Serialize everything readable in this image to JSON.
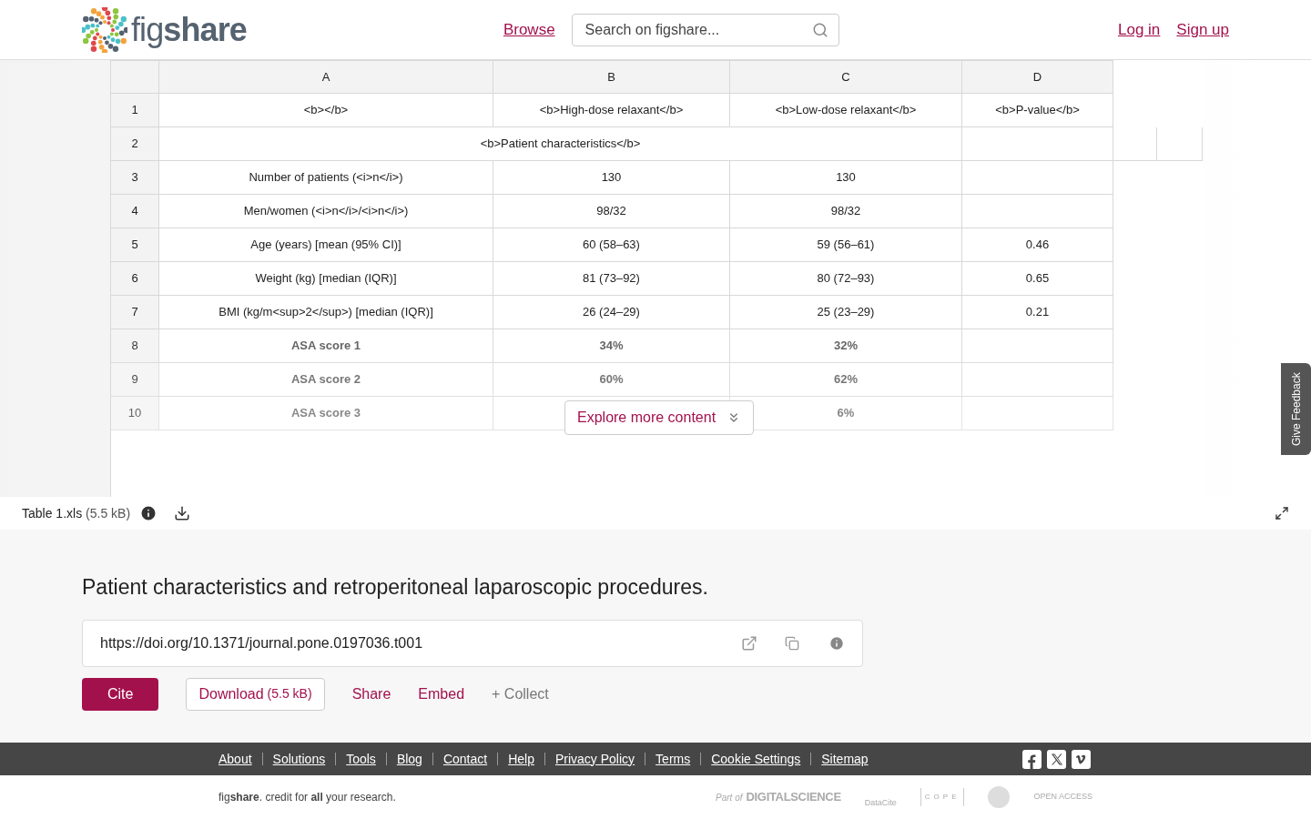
{
  "header": {
    "logo": "fig**share**",
    "nav": [
      {
        "label": "Browse"
      }
    ],
    "search": {
      "placeholder": "Search on figshare..."
    },
    "auth": [
      {
        "label": "Log in"
      },
      {
        "label": "Sign up"
      }
    ]
  },
  "sheet": {
    "columns": [
      "A",
      "B",
      "C",
      "D"
    ],
    "rows": [
      {
        "number": "1",
        "cells": [
          "<b></b>",
          "<b>High-dose relaxant</b>",
          "<b>Low-dose relaxant</b>",
          "<b>P-value</b>"
        ]
      },
      {
        "number": "2",
        "kind": "section",
        "cells": [
          {
            "text": "<b>Patient characteristics</b>",
            "colspan": 3
          }
        ]
      },
      {
        "number": "3",
        "cells": [
          "Number of patients (<i>n</i>)",
          "130",
          "130",
          null
        ]
      },
      {
        "number": "4",
        "cells": [
          "Men/women (<i>n</i>/<i>n</i>)",
          "98/32",
          "98/32",
          null
        ]
      },
      {
        "number": "5",
        "cells": [
          "Age (years) [mean (95% CI)]",
          "60 (58–63)",
          "59 (56–61)",
          "0.46"
        ]
      },
      {
        "number": "6",
        "cells": [
          "Weight (kg) [median (IQR)]",
          "81 (73–92)",
          "80 (72–93)",
          "0.65"
        ]
      },
      {
        "number": "7",
        "cells": [
          "BMI (kg/m<sup>2</sup>) [median (IQR)]",
          "26 (24–29)",
          "25 (23–29)",
          "0.21"
        ]
      },
      {
        "number": "8",
        "kind": "faded",
        "cells": [
          "ASA score 1",
          "34%",
          "32%",
          null
        ]
      },
      {
        "number": "9",
        "kind": "faded",
        "cells": [
          "ASA score 2",
          "60%",
          "62%",
          null
        ]
      },
      {
        "number": "10",
        "kind": "faded",
        "cells": [
          "ASA score 3",
          null,
          "6%",
          null
        ]
      }
    ],
    "explore": "Explore more content",
    "feedback": "Give Feedback"
  },
  "file": {
    "name": "Table 1.xls",
    "size": "(5.5 kB)"
  },
  "item": {
    "title": "Patient characteristics and retroperitoneal laparoscopic procedures.",
    "doi": "https://doi.org/10.1371/journal.pone.0197036.t001",
    "actions": [
      {
        "kind": "primary",
        "label": "Cite"
      },
      {
        "kind": "outline",
        "label": "Download",
        "note": "(5.5 kB)"
      },
      {
        "kind": "link",
        "label": "Share"
      },
      {
        "kind": "link",
        "label": "Embed"
      },
      {
        "kind": "muted",
        "label": "+ Collect"
      }
    ]
  },
  "footer": {
    "links": [
      "About",
      "Solutions",
      "Tools",
      "Blog",
      "Contact",
      "Help",
      "Privacy Policy",
      "Terms",
      "Cookie Settings",
      "Sitemap"
    ],
    "tagline": "fig**share**. credit for **all** your research.",
    "partners": [
      "Part of",
      "DIGITALSCIENCE",
      "DataCite",
      "COPE",
      "OPEN ACCESS"
    ]
  }
}
